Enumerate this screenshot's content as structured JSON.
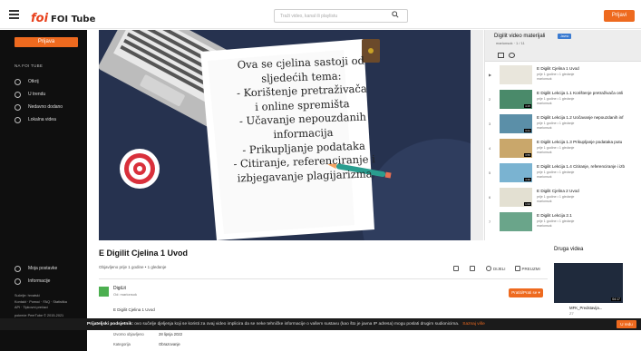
{
  "header": {
    "logo_mark": "foi",
    "logo_text": "FOI Tube",
    "search_placeholder": "Traži video, kanal ili playlistu",
    "login_label": "Prijavi"
  },
  "sidebar": {
    "login_button": "Prijava",
    "section_title": "NA FOI TUBE",
    "items": [
      {
        "label": "Otkrij"
      },
      {
        "label": "U trendu"
      },
      {
        "label": "Nedavno dodano"
      },
      {
        "label": "Lokalna videa"
      }
    ],
    "bottom_items": [
      {
        "label": "Moja postavke"
      },
      {
        "label": "Informacije"
      }
    ],
    "footer": [
      "Sučelje: hrvatski",
      "Kontakt · Pomoć · FAQ · Statistika",
      "API · Tipkovni prečaci",
      "pokreće PeerTube © 2015-2021"
    ]
  },
  "video": {
    "slide_lines": [
      "Ova se cjelina sastoji od",
      "sljedećih tema:",
      "- Korištenje pretraživača",
      "i online spremišta",
      "- Učavanje nepouzdanih",
      "informacija",
      "- Prikupljanje podataka",
      "- Citiranje, referenciranje i",
      "izbjegavanje plagijarizma"
    ],
    "title": "E Digilit Cjelina 1 Uvod",
    "meta": "Objavljeno prije 1 godine • 1 gledanje",
    "actions": {
      "like": "",
      "dislike": "",
      "share": "DIJELI",
      "download": "PREUZMI"
    },
    "channel_name": "DigiLit",
    "channel_sub": "Od: marionsok",
    "subscribe_label": "Pratiti/Prati se ▾",
    "description": "E Digilit Cjelina 1 Uvod",
    "details": [
      {
        "key": "Izvorno objavljeno",
        "value": "28 lipnja 2022"
      },
      {
        "key": "Kategorija",
        "value": "Obrazovanje"
      }
    ]
  },
  "playlist": {
    "title": "Digilit video materijali",
    "badge": "Javno",
    "meta": "marionsok · 1 / 11",
    "items": [
      {
        "num": "▶",
        "title": "E Digilit Cjelina 1 Uvod",
        "sub1": "prije 1 godine • 1 gledanje",
        "sub2": "marionsok",
        "dur": ""
      },
      {
        "num": "2",
        "title": "E Digilit Lekcija 1.1 Korištenje pretraživača onli",
        "sub1": "prije 1 godine • 1 gledanje",
        "sub2": "marionsok",
        "dur": "4:15"
      },
      {
        "num": "3",
        "title": "E Digilit Lekcija 1.2 Uočavanje nepouzdanih inf",
        "sub1": "prije 1 godine • 1 gledanje",
        "sub2": "marionsok",
        "dur": "3:41"
      },
      {
        "num": "4",
        "title": "E Digilit Lekcija 1.3 Prikupljanje podataka putu",
        "sub1": "prije 1 godine • 1 gledanje",
        "sub2": "marionsok",
        "dur": "3:55"
      },
      {
        "num": "5",
        "title": "E Digilit Lekcija 1.4 Citiranje, referenciranje i izb",
        "sub1": "prije 1 godine • 1 gledanje",
        "sub2": "marionsok",
        "dur": "4:40"
      },
      {
        "num": "6",
        "title": "E Digilit Cjelina 2 Uvod",
        "sub1": "prije 1 godine • 1 gledanje",
        "sub2": "marionsok",
        "dur": "1:02"
      },
      {
        "num": "7",
        "title": "E Digilit Lekcija 2.1",
        "sub1": "prije 1 godine • 1 gledanje",
        "sub2": "marionsok",
        "dur": ""
      }
    ]
  },
  "druga_videa": {
    "title": "Druga videa",
    "thumb_duration": "04:17",
    "item_title": "MFK_Predstavija...",
    "item_sub": "Z7"
  },
  "cookie": {
    "lead": "Prijateljski podsjetnik:",
    "text": " ovo sučelje djeljenja koji se koristi za ovaj video implicira da se neke tehničke informacije o vašem sustavu (kao što je javna IP adresa) mogu poslati drugim sudionicima.",
    "more": "Saznaj više",
    "button": "U redu"
  },
  "colors": {
    "accent": "#ee6a1f",
    "sidebar_bg": "#0f0f0f",
    "video_bg": "#26324f"
  }
}
